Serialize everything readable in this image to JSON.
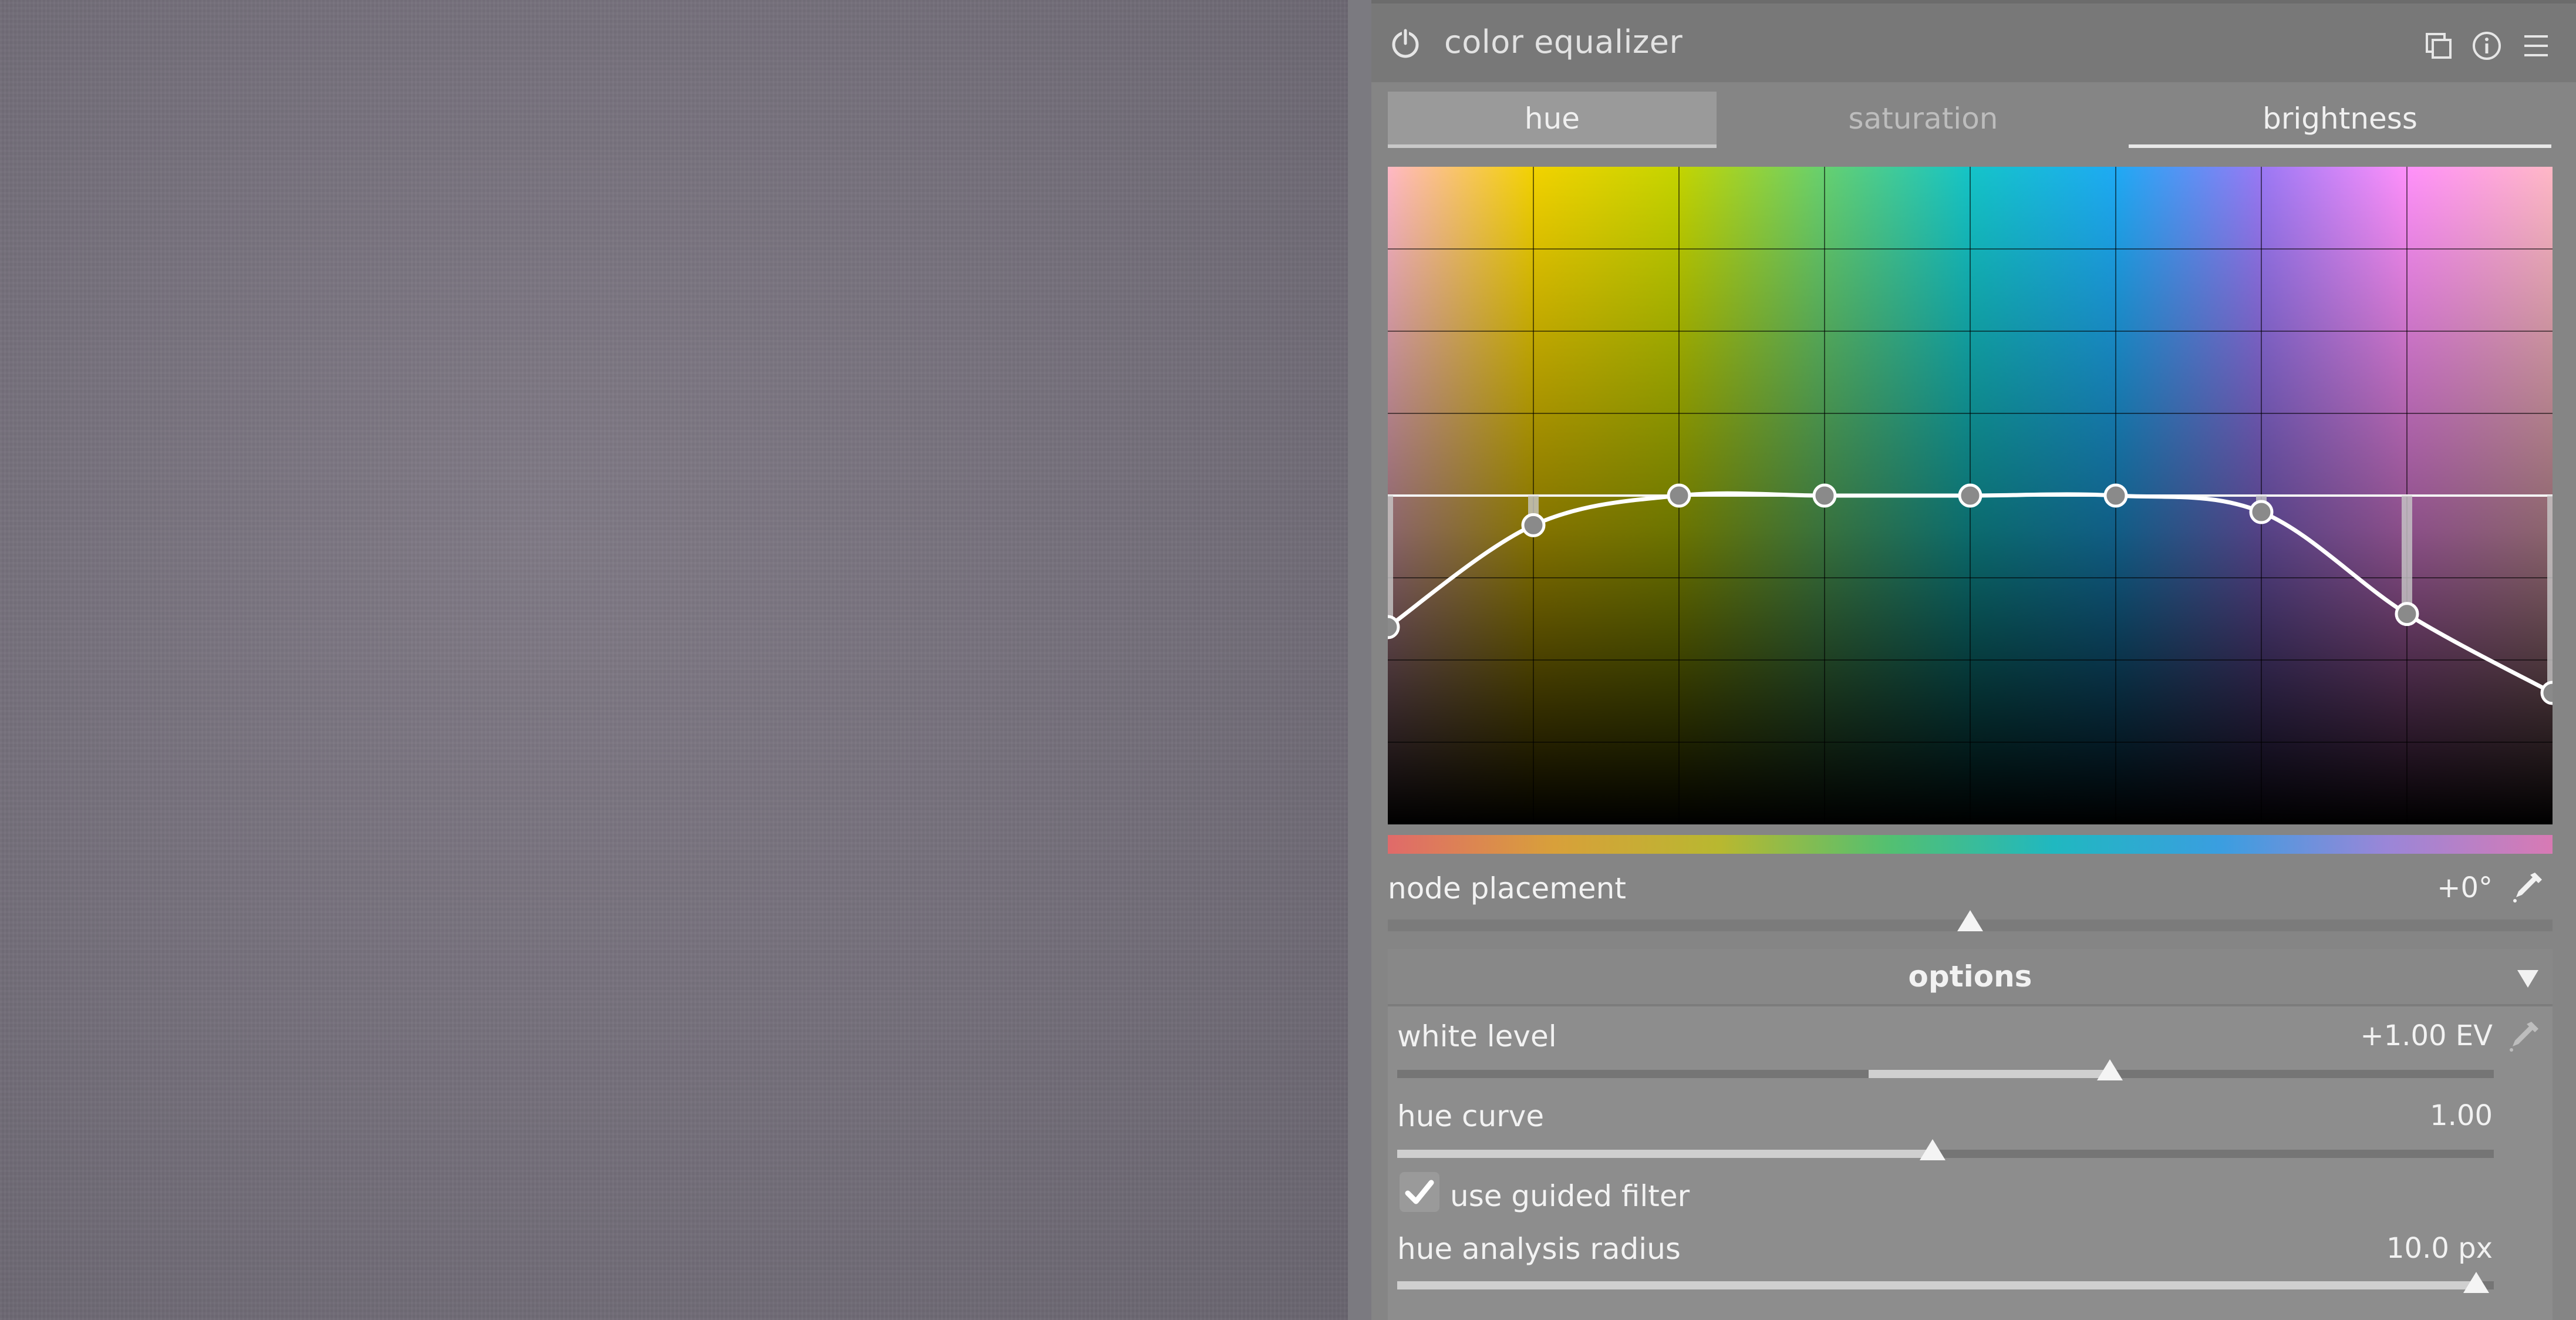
{
  "module": {
    "title": "color equalizer"
  },
  "tabs": [
    {
      "label": "hue",
      "active": false,
      "highlighted": true
    },
    {
      "label": "saturation",
      "active": false
    },
    {
      "label": "brightness",
      "active": true
    }
  ],
  "graph": {
    "grid_columns": 8,
    "grid_rows": 8,
    "hue_colors": [
      "#ffb8c6",
      "#f2d200",
      "#c4d400",
      "#66d070",
      "#14c4c8",
      "#1eaaf4",
      "#9a78f4",
      "#ff90fa",
      "#ffb8c6"
    ],
    "nodes": [
      {
        "hue_position": 0.0,
        "value": 0.3
      },
      {
        "hue_position": 0.125,
        "value": 0.455
      },
      {
        "hue_position": 0.25,
        "value": 0.5
      },
      {
        "hue_position": 0.375,
        "value": 0.5
      },
      {
        "hue_position": 0.5,
        "value": 0.5
      },
      {
        "hue_position": 0.625,
        "value": 0.5
      },
      {
        "hue_position": 0.75,
        "value": 0.475
      },
      {
        "hue_position": 0.875,
        "value": 0.32
      },
      {
        "hue_position": 1.0,
        "value": 0.2
      }
    ],
    "neutral_value": 0.5
  },
  "node_placement": {
    "label": "node placement",
    "value": "+0°",
    "position": 0.5
  },
  "options": {
    "title": "options",
    "white_level": {
      "label": "white level",
      "value": "+1.00 EV",
      "position": 0.65,
      "fill_start": 0.43
    },
    "hue_curve": {
      "label": "hue curve",
      "value": "1.00",
      "position": 0.488
    },
    "use_guided_filter": {
      "label": "use guided filter",
      "checked": true
    },
    "hue_analysis_radius": {
      "label": "hue analysis radius",
      "value": "10.0 px",
      "position": 1.0
    }
  }
}
